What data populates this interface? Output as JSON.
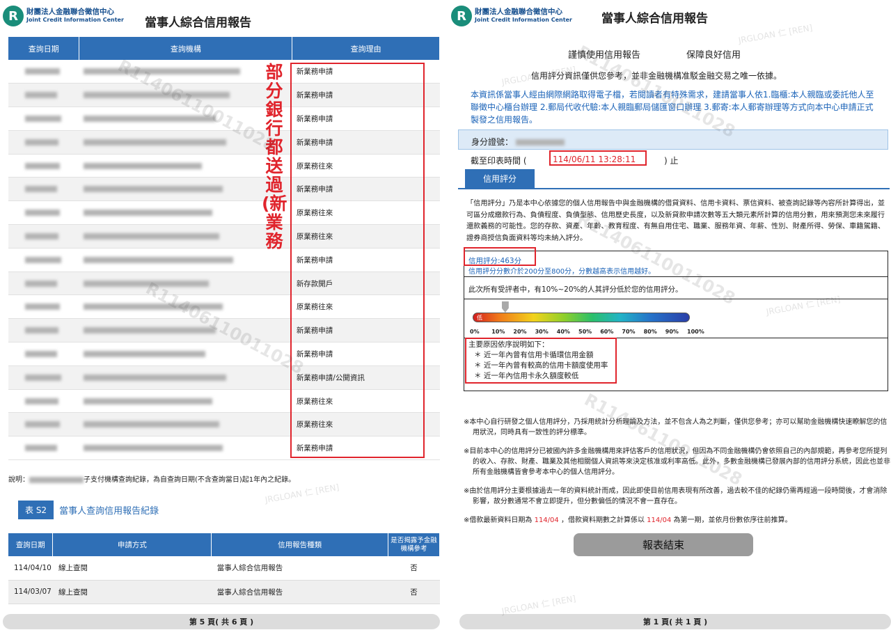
{
  "brand": {
    "logo_mark": "R",
    "name_cn": "財團法人金融聯合徵信中心",
    "name_en": "Joint Credit Information Center"
  },
  "left": {
    "title": "當事人綜合信用報告",
    "inquiry_table": {
      "headers": [
        "查詢日期",
        "查詢機構",
        "查詢理由"
      ],
      "reasons": [
        "新業務申請",
        "新業務申請",
        "新業務申請",
        "新業務申請",
        "原業務往來",
        "新業務申請",
        "原業務往來",
        "原業務往來",
        "新業務申請",
        "新存款開戶",
        "原業務往來",
        "新業務申請",
        "新業務申請",
        "新業務申請/公開資訊",
        "原業務往來",
        "原業務往來",
        "新業務申請"
      ]
    },
    "annotation": "部分銀行都送過(新業務",
    "note_prefix": "說明：",
    "note_suffix": "子支付機構查詢紀錄，為自查詢日期(不含查詢當日)起1年內之紀錄。",
    "s2_tag": "表 S2",
    "s2_title": "當事人查詢信用報告紀錄",
    "s2_table": {
      "headers": [
        "查詢日期",
        "申請方式",
        "信用報告種類",
        "是否揭露予金融機構參考"
      ],
      "rows": [
        [
          "114/04/10",
          "線上查閱",
          "當事人綜合信用報告",
          "否"
        ],
        [
          "114/03/07",
          "線上查閱",
          "當事人綜合信用報告",
          "否"
        ]
      ]
    },
    "footer": "第 5 頁( 共 6 頁 )"
  },
  "right": {
    "title": "當事人綜合信用報告",
    "slogan_1": "謹慎使用信用報告",
    "slogan_2": "保障良好信用",
    "line1": "信用評分資訊僅供您參考，並非金融機構准駁金融交易之唯一依據。",
    "blue_text": "本資訊係當事人經由網際網路取得電子檔，若閱讀者有特殊需求，建請當事人依1.臨櫃:本人親臨或委託他人至聯徵中心櫃台辦理 2.郵局代收代驗:本人親臨郵局儲匯窗口辦理 3.郵寄:本人郵寄辦理等方式向本中心申請正式製發之信用報告。",
    "id_label": "身分證號：",
    "print_time_label": "截至印表時間 (",
    "print_time_value": "114/06/11 13:28:11",
    "print_time_end": ") 止",
    "score_tab": "信用評分",
    "description": "「信用評分」乃是本中心依據您的個人信用報告中與金融機構的借貸資料、信用卡資料、票信資料、被查詢記錄等內容所計算得出，並可區分成繳款行為、負債程度、負債型態、信用歷史長度，以及新貸款申請次數等五大類元素所計算的信用分數，用來預測您未來履行還款義務的可能性。您的存款、資產、年齡、教育程度、有無自用住宅、職業、服務年資、年薪、性別、財產所得、勞保、車籍駕籍、證券商授信負面資料等均未納入評分。",
    "score_value": "信用評分:463分",
    "score_range": "信用評分分數介於200分至800分，分數越高表示信用越好。",
    "percentile_text": "此次所有受評者中，有10%~20%的人其評分低於您的信用評分。",
    "gauge_low_label": "低",
    "gauge_ticks": [
      "0%",
      "10%",
      "20%",
      "30%",
      "40%",
      "50%",
      "60%",
      "70%",
      "80%",
      "90%",
      "100%"
    ],
    "gauge_marker_percent": 15,
    "reasons_title": "主要原因依序說明如下：",
    "reasons": [
      "＊ 近一年內曾有信用卡循環信用金額",
      "＊ 近一年內曾有較高的信用卡額度使用率",
      "＊ 近一年內信用卡永久額度較低"
    ],
    "note_1": "※本中心自行研發之個人信用評分，乃採用統計分析理論及方法，並不包含人為之判斷，僅供您參考；亦可以幫助金融機構快速瞭解您的信用狀況，同時具有一致性的評分標準。",
    "note_2": "※目前本中心的信用評分已被國內許多金融機構用來評估客戶的信用狀況，但因為不同金融機構仍會依照自己的內部規範，再參考您所提列的收入、存款、財產、職業及其他相關個人資訊等來決定核准或利率高低。此外，多數金融機構已發展內部的信用評分系統，因此也並非所有金融機構皆會參考本中心的個人信用評分。",
    "note_3": "※由於信用評分主要根據過去一年的資料統計而成，因此即使目前信用表現有所改善，過去較不佳的紀錄仍需再經過一段時間後，才會消除影響，故分數通常不會立即提升，但分數偏低的情況不會一直存在。",
    "note_4_a": "※借款最新資料日期為",
    "note_4_b": "114/04",
    "note_4_c": "，借款資料期數之計算係以",
    "note_4_d": "114/04",
    "note_4_e": "為第一期，並依月份數依序往前推算。",
    "end_button": "報表結束",
    "footer": "第 1 頁( 共 1 頁 )"
  },
  "watermarks": {
    "id_code": "R11406110011028",
    "tag": "JRGLOAN 仁 [REN]"
  },
  "colors": {
    "header_blue": "#2f6fb6",
    "annotation_red": "#e0242c",
    "logo_green": "#1a8d7a"
  }
}
